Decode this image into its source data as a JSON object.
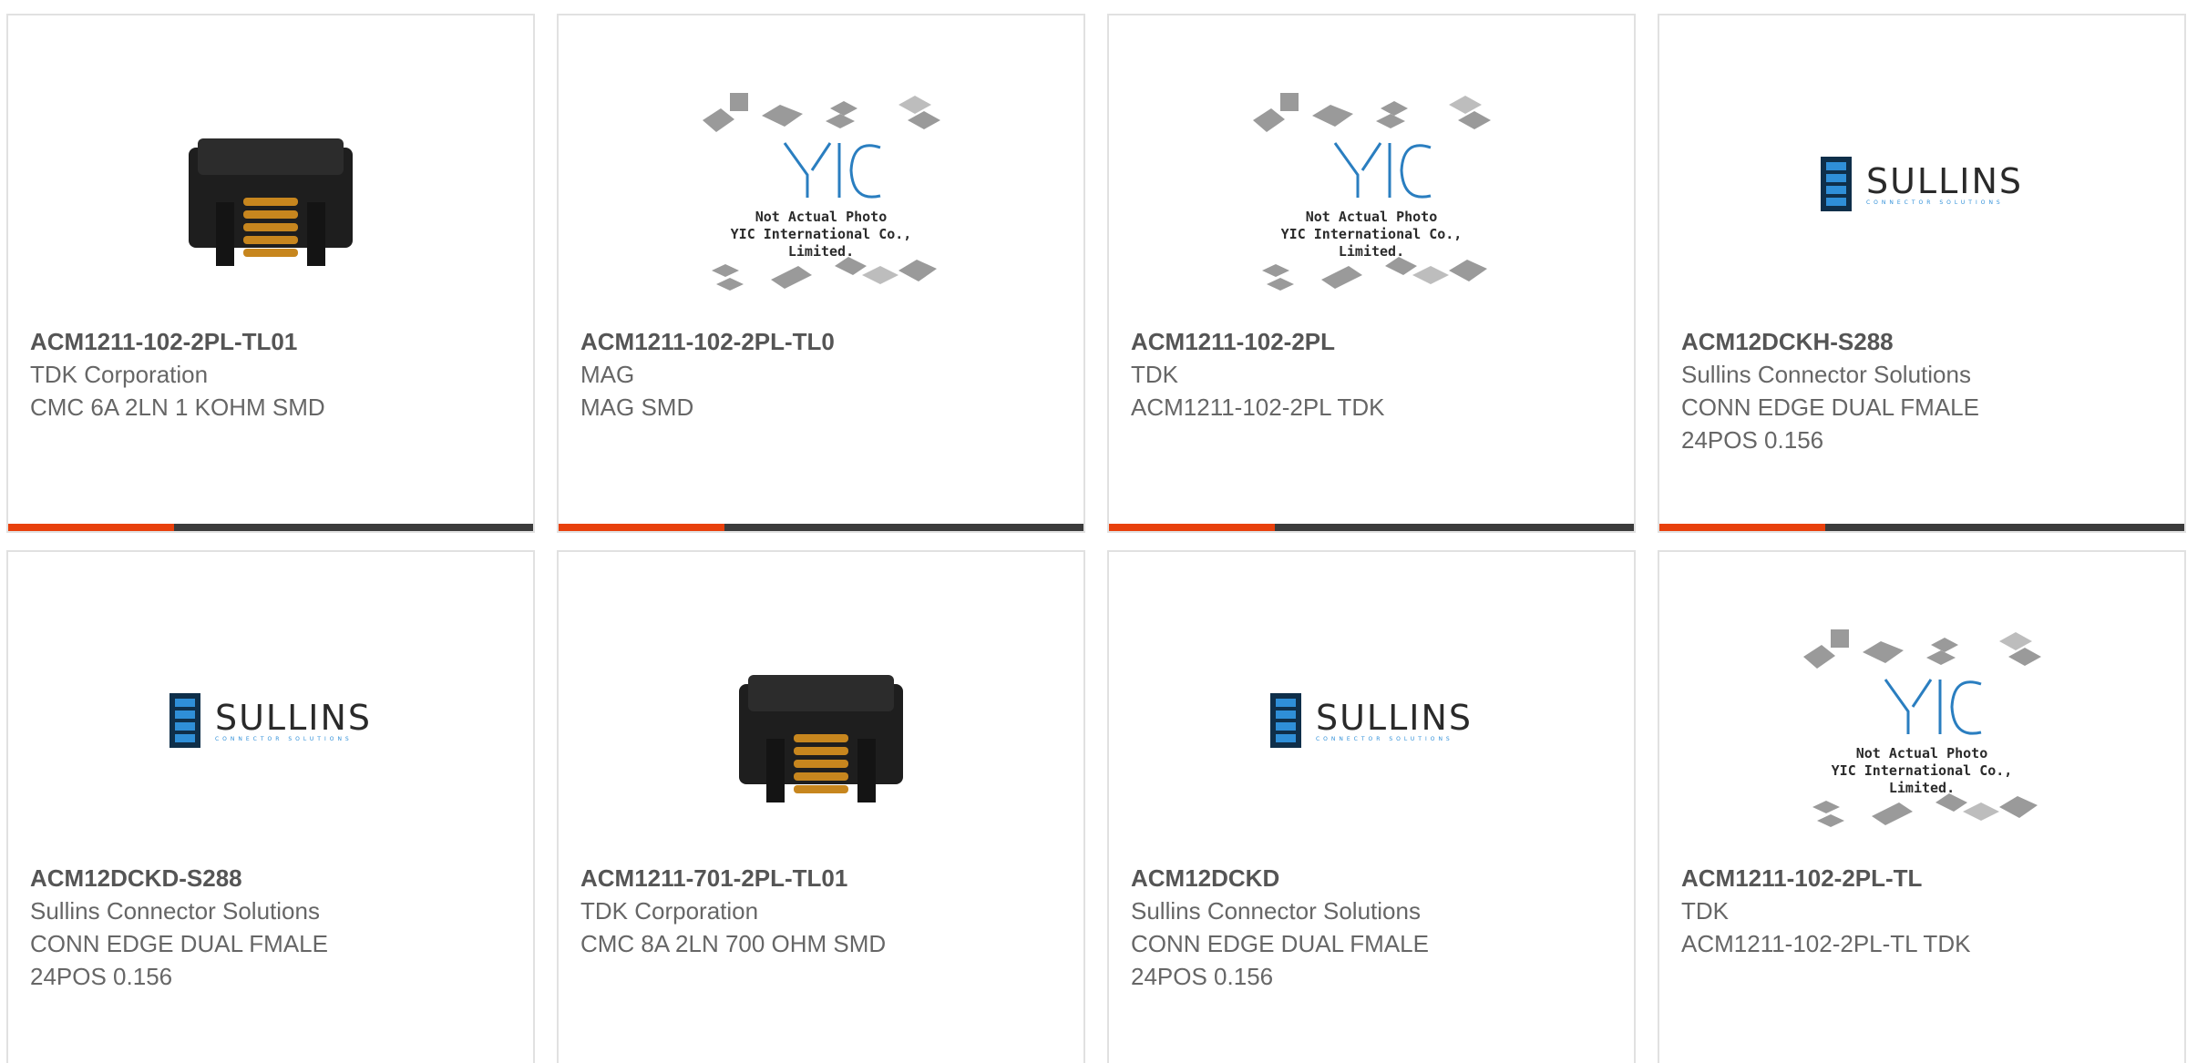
{
  "colors": {
    "accent": "#e8400c",
    "bar": "#3b3b3b",
    "text": "#666666"
  },
  "products": [
    {
      "part_number": "ACM1211-102-2PL-TL01",
      "manufacturer": "TDK Corporation",
      "description_lines": [
        "CMC 6A 2LN 1 KOHM SMD"
      ],
      "image": "inductor-photo"
    },
    {
      "part_number": "ACM1211-102-2PL-TL0",
      "manufacturer": "MAG",
      "description_lines": [
        "MAG SMD"
      ],
      "image": "yic-placeholder",
      "image_text": [
        "Not Actual Photo",
        "YIC International Co., Limited."
      ]
    },
    {
      "part_number": "ACM1211-102-2PL",
      "manufacturer": "TDK",
      "description_lines": [
        "ACM1211-102-2PL TDK"
      ],
      "image": "yic-placeholder",
      "image_text": [
        "Not Actual Photo",
        "YIC International Co., Limited."
      ]
    },
    {
      "part_number": "ACM12DCKH-S288",
      "manufacturer": "Sullins Connector Solutions",
      "description_lines": [
        "CONN EDGE DUAL FMALE",
        "24POS 0.156"
      ],
      "image": "sullins-logo",
      "image_text": [
        "SULLINS",
        "CONNECTOR SOLUTIONS"
      ]
    },
    {
      "part_number": "ACM12DCKD-S288",
      "manufacturer": "Sullins Connector Solutions",
      "description_lines": [
        "CONN EDGE DUAL FMALE",
        "24POS 0.156"
      ],
      "image": "sullins-logo",
      "image_text": [
        "SULLINS",
        "CONNECTOR SOLUTIONS"
      ]
    },
    {
      "part_number": "ACM1211-701-2PL-TL01",
      "manufacturer": "TDK Corporation",
      "description_lines": [
        "CMC 8A 2LN 700 OHM SMD"
      ],
      "image": "inductor-photo"
    },
    {
      "part_number": "ACM12DCKD",
      "manufacturer": "Sullins Connector Solutions",
      "description_lines": [
        "CONN EDGE DUAL FMALE",
        "24POS 0.156"
      ],
      "image": "sullins-logo",
      "image_text": [
        "SULLINS",
        "CONNECTOR SOLUTIONS"
      ]
    },
    {
      "part_number": "ACM1211-102-2PL-TL",
      "manufacturer": "TDK",
      "description_lines": [
        "ACM1211-102-2PL-TL TDK"
      ],
      "image": "yic-placeholder",
      "image_text": [
        "Not Actual Photo",
        "YIC International Co., Limited."
      ]
    }
  ]
}
